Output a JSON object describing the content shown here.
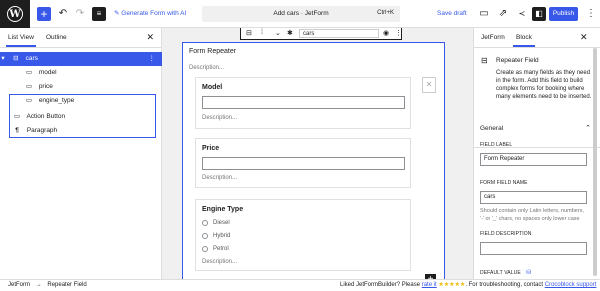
{
  "topbar": {
    "ai_label": "Generate Form with AI",
    "doc_title": "Add cars · JetForm",
    "shortcut": "Ctrl+K",
    "save_draft": "Save draft",
    "publish": "Publish"
  },
  "left_panel": {
    "tabs": [
      "List View",
      "Outline"
    ],
    "tree": [
      {
        "label": "cars",
        "icon": "repeater-icon"
      },
      {
        "label": "model",
        "icon": "text-field-icon"
      },
      {
        "label": "price",
        "icon": "text-field-icon"
      },
      {
        "label": "engine_type",
        "icon": "text-field-icon"
      },
      {
        "label": "Action Button",
        "icon": "button-icon"
      },
      {
        "label": "Paragraph",
        "icon": "paragraph-icon"
      }
    ]
  },
  "canvas": {
    "toolbar_value": "cars",
    "repeater_title": "Form Repeater",
    "repeater_desc": "Description...",
    "fields": [
      {
        "label": "Model",
        "desc": "Description..."
      },
      {
        "label": "Price",
        "desc": "Description..."
      },
      {
        "label": "Engine Type",
        "desc": "Description...",
        "options": [
          "Diesel",
          "Hybrid",
          "Petrol"
        ]
      }
    ]
  },
  "right_panel": {
    "tabs": [
      "JetForm",
      "Block"
    ],
    "block_name": "Repeater Field",
    "block_desc": "Create as many fields as they need in the form. Add this field to build complex forms for booking where many elements need to be inserted.",
    "section": "General",
    "field_label_label": "FIELD LABEL",
    "field_label_value": "Form Repeater",
    "form_field_name_label": "FORM FIELD NAME",
    "form_field_name_value": "cars",
    "form_field_name_help": "Should contain only Latin letters, numbers, '-' or '_' chars, no spaces only lower case",
    "field_desc_label": "FIELD DESCRIPTION",
    "default_value_label": "DEFAULT VALUE"
  },
  "footer": {
    "crumb_root": "JetForm",
    "crumb_sep": "→",
    "crumb_leaf": "Repeater Field",
    "note_prefix": "Liked JetFormBuilder? Please ",
    "rate_link": "rate it",
    "stars": "★★★★★",
    "note_mid": ". For troubleshooting, contact ",
    "support_link": "Crocoblock support"
  }
}
